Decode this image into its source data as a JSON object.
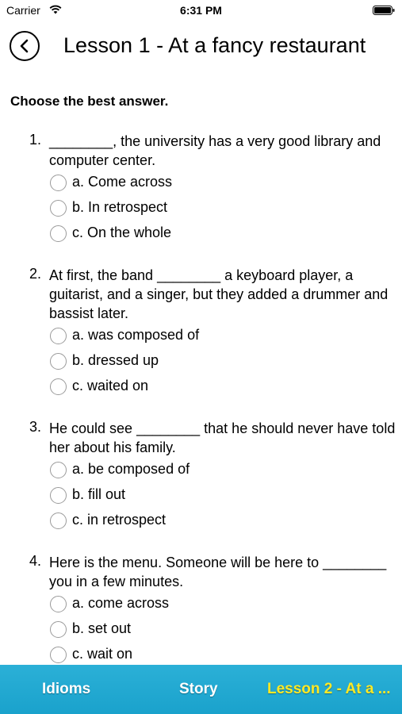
{
  "status": {
    "carrier": "Carrier",
    "time": "6:31 PM"
  },
  "header": {
    "title": "Lesson 1 - At a fancy restaurant"
  },
  "instructions": "Choose the best answer.",
  "questions": [
    {
      "number": "1.",
      "text": "________, the university has a very good library and computer center.",
      "options": [
        "a. Come across",
        "b. In retrospect",
        "c. On the whole"
      ]
    },
    {
      "number": "2.",
      "text": "At first, the band ________ a keyboard player, a guitarist, and a singer, but they added a drummer and bassist later.",
      "options": [
        "a. was composed of",
        "b. dressed up",
        "c. waited on"
      ]
    },
    {
      "number": "3.",
      "text": "He could see ________ that he should never have told her about his family.",
      "options": [
        "a. be composed of",
        "b. fill out",
        "c. in retrospect"
      ]
    },
    {
      "number": "4.",
      "text": "Here is the menu. Someone will be here to ________ you in a few minutes.",
      "options": [
        "a. come across",
        "b. set out",
        "c. wait on"
      ]
    }
  ],
  "tabs": [
    "Idioms",
    "Story",
    "Lesson 2 - At a ..."
  ],
  "colors": {
    "tab_bar": "#1ea7d1",
    "active_tab": "#ffe924"
  }
}
